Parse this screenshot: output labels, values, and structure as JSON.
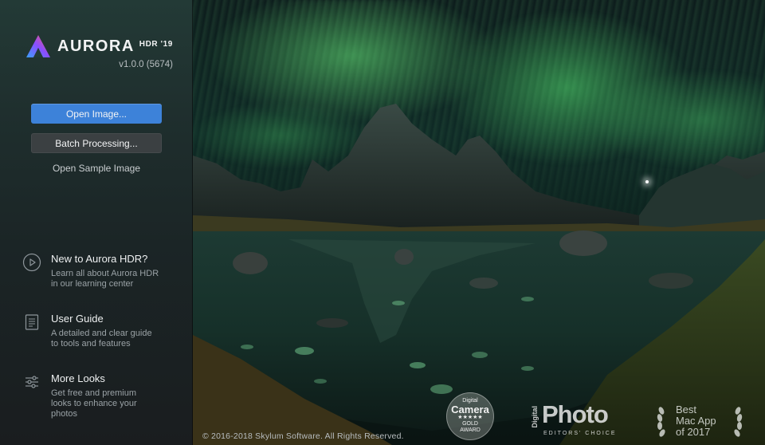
{
  "app": {
    "name": "AURORA",
    "edition": "HDR '19",
    "version": "v1.0.0 (5674)"
  },
  "actions": {
    "open_image": "Open Image...",
    "batch_processing": "Batch Processing...",
    "open_sample": "Open Sample Image"
  },
  "resources": [
    {
      "title": "New to Aurora HDR?",
      "desc_line1": "Learn all about Aurora HDR",
      "desc_line2": "in our learning center",
      "icon": "play-circle-icon"
    },
    {
      "title": "User Guide",
      "desc_line1": "A detailed and clear guide",
      "desc_line2": "to tools and features",
      "icon": "document-icon"
    },
    {
      "title": "More Looks",
      "desc_line1": "Get free and premium",
      "desc_line2": "looks to enhance your",
      "desc_line3": "photos",
      "icon": "sliders-icon"
    }
  ],
  "footer": {
    "copyright": "© 2016-2018 Skylum Software. All Rights Reserved."
  },
  "awards": {
    "camera_line1": "Digital",
    "camera_line2": "Camera",
    "camera_stars": "★★★★★",
    "camera_line3": "GOLD",
    "camera_line4": "AWARD",
    "photo_prefix": "Digital",
    "photo_main": "Photo",
    "photo_sub": "EDITORS' CHOICE",
    "mac_line1": "Best",
    "mac_line2": "Mac App",
    "mac_line3": "of 2017"
  },
  "colors": {
    "primary_button": "#3d82d9",
    "aurora_green": "#5fe07a"
  }
}
